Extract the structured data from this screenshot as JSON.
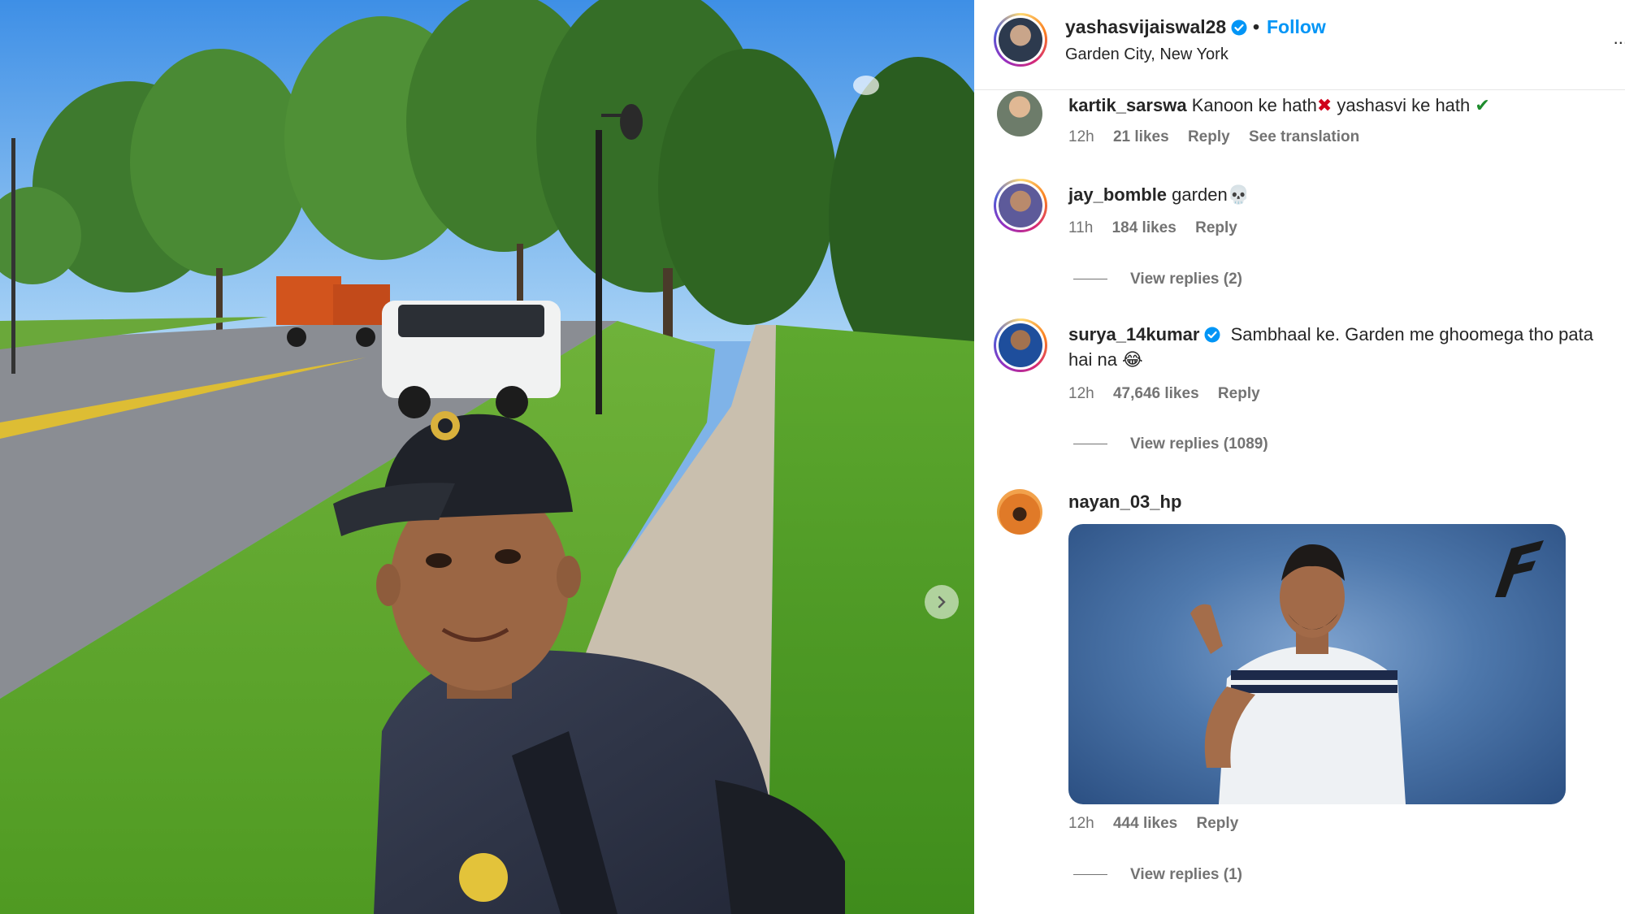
{
  "post": {
    "owner_username": "yashasvijaiswal28",
    "follow_label": "Follow",
    "separator": "•",
    "location": "Garden City, New York",
    "more_label": "..."
  },
  "comments": [
    {
      "username": "kartik_sarswa",
      "text_before": "Kanoon ke hath",
      "emoji_1": "✖",
      "text_middle": "yashasvi ke hath",
      "emoji_2": "✔",
      "time": "12h",
      "likes": "21 likes",
      "reply_label": "Reply",
      "translation_label": "See translation"
    },
    {
      "username": "jay_bomble",
      "text": "garden💀",
      "time": "11h",
      "likes": "184 likes",
      "reply_label": "Reply",
      "view_replies": "View replies (2)"
    },
    {
      "username": "surya_14kumar",
      "verified": true,
      "text": "Sambhaal ke. Garden me ghoomega tho pata hai na 😂",
      "time": "12h",
      "likes": "47,646 likes",
      "reply_label": "Reply",
      "view_replies": "View replies (1089)"
    },
    {
      "username": "nayan_03_hp",
      "has_gif": true,
      "time": "12h",
      "likes": "444 likes",
      "reply_label": "Reply",
      "view_replies": "View replies (1)"
    }
  ],
  "colors": {
    "link_blue": "#0095f6",
    "verified_blue": "#0095f6",
    "meta_gray": "#737373",
    "text_dark": "#262626"
  },
  "icons": [
    "verified-badge-icon",
    "chevron-right-icon",
    "more-options-icon",
    "red-cross-icon",
    "green-check-icon"
  ]
}
